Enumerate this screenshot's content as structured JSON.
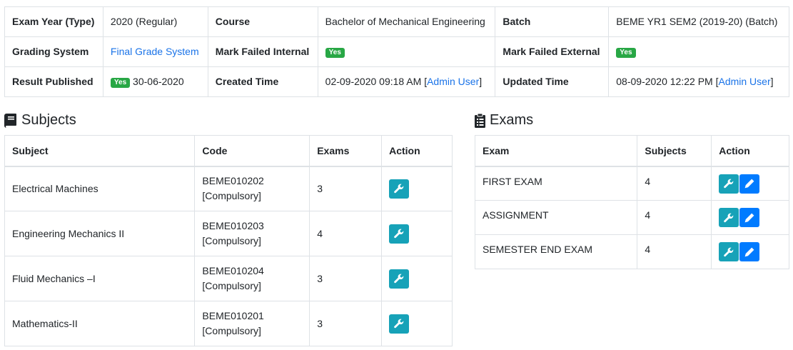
{
  "info": {
    "rows": [
      [
        {
          "label": "Exam Year (Type)",
          "value": "2020 (Regular)"
        },
        {
          "label": "Course",
          "value": "Bachelor of Mechanical Engineering"
        },
        {
          "label": "Batch",
          "value": "BEME YR1 SEM2 (2019-20) (Batch)"
        }
      ]
    ],
    "grading_label": "Grading System",
    "grading_value": "Final Grade System",
    "mark_failed_internal_label": "Mark Failed Internal",
    "mark_failed_internal_badge": "Yes",
    "mark_failed_external_label": "Mark Failed External",
    "mark_failed_external_badge": "Yes",
    "result_published_label": "Result Published",
    "result_published_badge": "Yes",
    "result_published_date": "30-06-2020",
    "created_label": "Created Time",
    "created_time": "02-09-2020 09:18 AM [",
    "created_user": "Admin User",
    "updated_label": "Updated Time",
    "updated_time": "08-09-2020 12:22 PM [",
    "updated_user": "Admin User",
    "close_bracket": "]"
  },
  "subjects": {
    "title": "Subjects",
    "headers": [
      "Subject",
      "Code",
      "Exams",
      "Action"
    ],
    "rows": [
      {
        "subject": "Electrical Machines",
        "code": "BEME010202",
        "type": "[Compulsory]",
        "exams": "3"
      },
      {
        "subject": "Engineering Mechanics II",
        "code": "BEME010203",
        "type": "[Compulsory]",
        "exams": "4"
      },
      {
        "subject": "Fluid Mechanics –I",
        "code": "BEME010204",
        "type": "[Compulsory]",
        "exams": "3"
      },
      {
        "subject": "Mathematics-II",
        "code": "BEME010201",
        "type": "[Compulsory]",
        "exams": "3"
      }
    ]
  },
  "exams": {
    "title": "Exams",
    "headers": [
      "Exam",
      "Subjects",
      "Action"
    ],
    "rows": [
      {
        "exam": "FIRST EXAM",
        "subjects": "4"
      },
      {
        "exam": "ASSIGNMENT",
        "subjects": "4"
      },
      {
        "exam": "SEMESTER END EXAM",
        "subjects": "4"
      }
    ]
  },
  "icons": {
    "subjects_heading": "book-icon",
    "exams_heading": "clipboard-icon",
    "configure": "wrench-icon",
    "edit": "pencil-icon"
  },
  "colors": {
    "badge": "#28a745",
    "link": "#1a73e8",
    "info_button": "#17a2b8",
    "primary_button": "#007bff"
  }
}
